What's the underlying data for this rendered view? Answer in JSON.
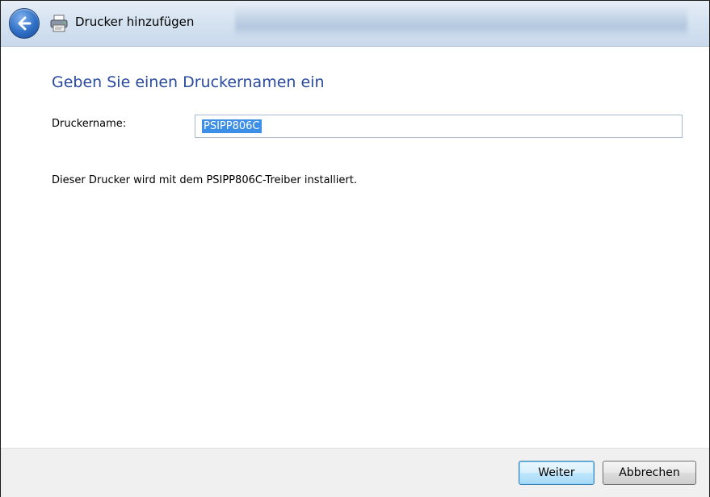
{
  "window": {
    "title": "Drucker hinzufügen"
  },
  "icons": {
    "back": "back-arrow-icon",
    "printer": "printer-icon"
  },
  "main": {
    "heading": "Geben Sie einen Druckernamen ein",
    "printer_name_label": "Druckername:",
    "printer_name_value": "PSIPP806C",
    "info_text": "Dieser Drucker wird mit dem PSIPP806C-Treiber installiert."
  },
  "footer": {
    "next_label": "Weiter",
    "cancel_label": "Abbrechen"
  },
  "colors": {
    "heading": "#2a4a9e",
    "selection": "#3d8ee6",
    "footer_bg": "#f0f0f0"
  }
}
